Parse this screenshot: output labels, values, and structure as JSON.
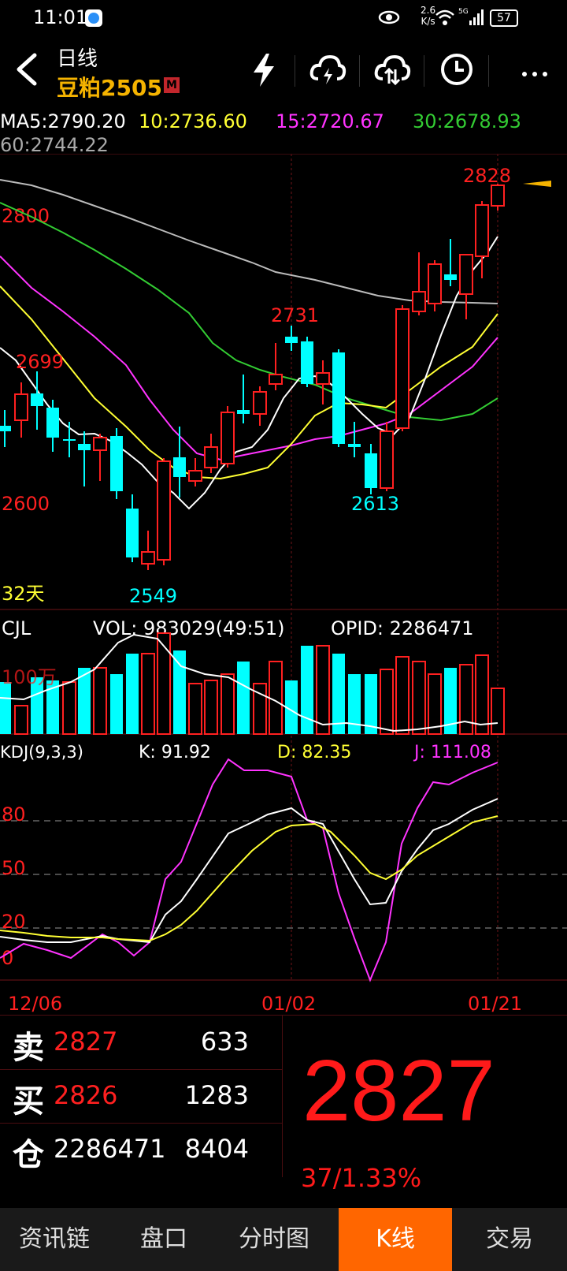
{
  "status": {
    "time": "11:01",
    "net_speed": "2.6",
    "net_unit": "K/s",
    "signal": "5G",
    "battery": "57"
  },
  "header": {
    "title": "日线",
    "symbol": "豆粕2505",
    "badge": "M",
    "icons": [
      "back-icon",
      "lightning-icon",
      "cloud-flash-icon",
      "cloud-compare-icon",
      "clock-icon",
      "more-icon"
    ]
  },
  "ma": {
    "ma5": "MA5:2790.20",
    "ma10": "10:2736.60",
    "ma15": "15:2720.67",
    "ma30": "30:2678.93",
    "ma60": "60:2744.22",
    "colors": {
      "ma5": "#ffffff",
      "ma10": "#ffff33",
      "ma15": "#ff33ff",
      "ma30": "#33cc33",
      "ma60": "#bbbbbb"
    }
  },
  "kline": {
    "price_label_high": "2800",
    "price_label_low": "2600",
    "days": "32天",
    "annot_max": "2828",
    "annot_2731": "2731",
    "annot_2699": "2699",
    "annot_2613": "2613",
    "annot_2549": "2549",
    "up_color": "#ff2020",
    "down_color": "#00ffff"
  },
  "volume": {
    "label": "CJL",
    "vol": "VOL: 983029(49:51)",
    "opid": "OPID: 2286471",
    "axis": "100万"
  },
  "kdj": {
    "label": "KDJ(9,3,3)",
    "k": "K: 91.92",
    "d": "D: 82.35",
    "j": "J: 111.08",
    "levels": [
      "80",
      "50",
      "20",
      "0"
    ]
  },
  "dates": [
    "12/06",
    "01/02",
    "01/21"
  ],
  "quote": {
    "sell_label": "卖",
    "sell_price": "2827",
    "sell_vol": "633",
    "buy_label": "买",
    "buy_price": "2826",
    "buy_vol": "1283",
    "oi_label": "仓",
    "oi_value": "2286471",
    "oi_change": "8404",
    "last": "2827",
    "change": "37/1.33%"
  },
  "nav": {
    "items": [
      "资讯链",
      "盘口",
      "分时图",
      "K线",
      "交易"
    ],
    "active": "K线"
  }
}
